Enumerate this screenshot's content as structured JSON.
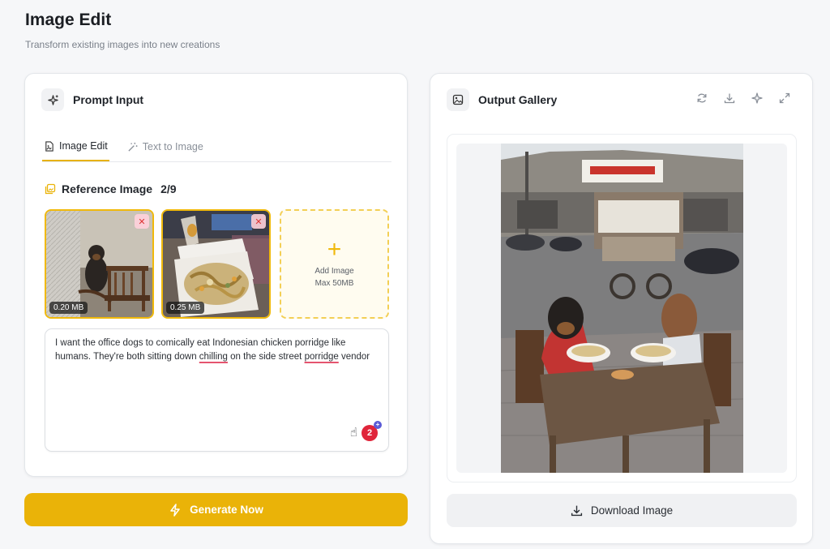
{
  "page": {
    "title": "Image Edit",
    "subtitle": "Transform existing images into new creations"
  },
  "prompt_panel": {
    "title": "Prompt Input",
    "tabs": [
      {
        "label": "Image Edit",
        "active": true
      },
      {
        "label": "Text to Image",
        "active": false
      }
    ],
    "reference": {
      "label": "Reference Image",
      "count": "2/9",
      "images": [
        {
          "size": "0.20 MB",
          "content": "rottweiler dog sitting beside wooden chair"
        },
        {
          "size": "0.25 MB",
          "content": "chicken porridge in styrofoam container"
        }
      ],
      "add": {
        "label": "Add Image",
        "limit": "Max 50MB"
      }
    },
    "prompt": {
      "segments": [
        {
          "text": "I want the office dogs to comically eat Indonesian chicken porridge like humans. They're both sitting down ",
          "misspelled": false
        },
        {
          "text": "chilling",
          "misspelled": true
        },
        {
          "text": " on the side street ",
          "misspelled": false
        },
        {
          "text": "porridge",
          "misspelled": true
        },
        {
          "text": " vendor",
          "misspelled": false
        }
      ]
    },
    "extensions": {
      "badge_count": "2"
    }
  },
  "generate_button": {
    "label": "Generate Now"
  },
  "output_panel": {
    "title": "Output Gallery",
    "actions": [
      "refresh-icon",
      "download-icon",
      "sparkle-icon",
      "expand-icon"
    ],
    "image": {
      "content": "two dogs sitting at a wooden table eating bowls of chicken porridge on a street with a food cart"
    },
    "download_button": {
      "label": "Download Image"
    }
  },
  "colors": {
    "accent": "#eab308",
    "accent_border": "#f0b90b",
    "background": "#f6f7f9"
  }
}
